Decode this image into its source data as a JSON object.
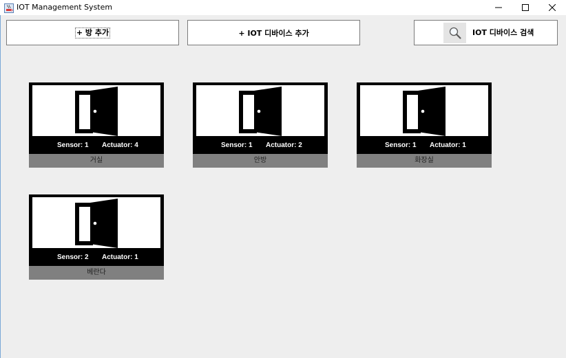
{
  "window": {
    "title": "IOT Management System"
  },
  "toolbar": {
    "add_room_label": "+ 방 추가",
    "add_device_label": "+ IOT 디바이스 추가",
    "search_label": "IOT 디바이스 검색"
  },
  "rooms": [
    {
      "name": "거실",
      "sensor": "Sensor: 1",
      "actuator": "Actuator: 4"
    },
    {
      "name": "안방",
      "sensor": "Sensor: 1",
      "actuator": "Actuator: 2"
    },
    {
      "name": "화장실",
      "sensor": "Sensor: 1",
      "actuator": "Actuator: 1"
    },
    {
      "name": "베란다",
      "sensor": "Sensor: 2",
      "actuator": "Actuator: 1"
    }
  ],
  "icons": {
    "app": "java-cup-icon",
    "room": "open-door-icon",
    "search": "magnifier-icon"
  }
}
